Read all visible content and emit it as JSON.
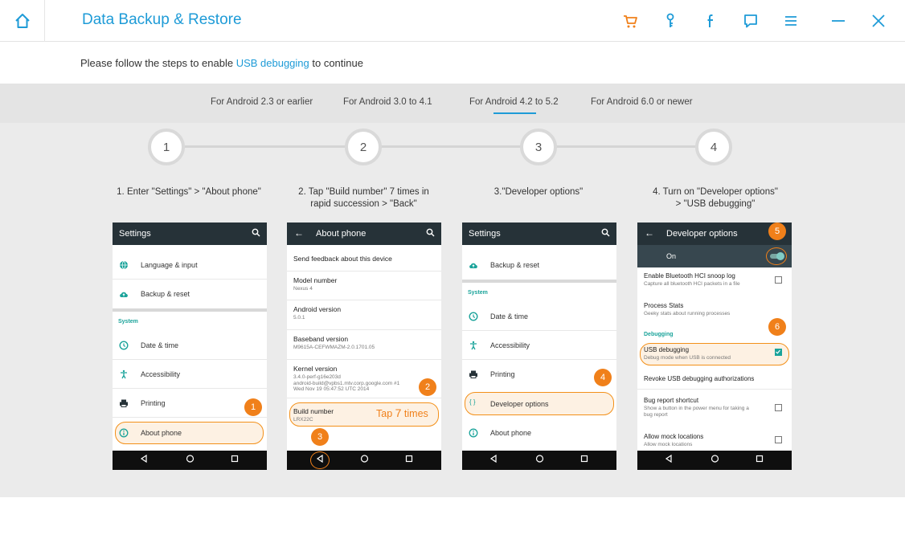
{
  "app": {
    "title": "Data Backup & Restore"
  },
  "instruction": {
    "prefix": "Please follow the steps to enable ",
    "link": "USB debugging",
    "suffix": " to continue"
  },
  "tabs": [
    {
      "label": "For Android 2.3 or earlier"
    },
    {
      "label": "For Android 3.0 to 4.1"
    },
    {
      "label": "For Android 4.2 to 5.2",
      "selected": true
    },
    {
      "label": "For Android 6.0 or newer"
    }
  ],
  "steps": [
    {
      "number": "1",
      "caption_lines": [
        "1. Enter \"Settings\" > \"About phone\""
      ]
    },
    {
      "number": "2",
      "caption_lines": [
        "2. Tap \"Build number\" 7   times in",
        "rapid succession > \"Back\""
      ]
    },
    {
      "number": "3",
      "caption_lines": [
        "3.\"Developer options\""
      ]
    },
    {
      "number": "4",
      "caption_lines": [
        "4. Turn on \"Developer       options\"",
        "> \"USB debugging\""
      ]
    }
  ],
  "phone1": {
    "title": "Settings",
    "items": [
      "Language & input",
      "Backup & reset"
    ],
    "section": "System",
    "system_items": [
      "Date & time",
      "Accessibility",
      "Printing",
      "About phone"
    ],
    "badge": "1"
  },
  "phone2": {
    "title": "About phone",
    "feedback": "Send feedback about this device",
    "model_label": "Model number",
    "model_value": "Nexus 4",
    "android_label": "Android version",
    "android_value": "5.0.1",
    "baseband_label": "Baseband version",
    "baseband_value": "M9615A-CEFWMAZM-2.0.1701.05",
    "kernel_label": "Kernel version",
    "kernel_value_1": "3.4.0-perf-g16e203d",
    "kernel_value_2": "android-build@vpbs1.mtv.corp.google.com #1",
    "kernel_value_3": "Wed Nov 19 05:47:52 UTC 2014",
    "build_label": "Build number",
    "build_value": "LRX22C",
    "tap_prefix": "Tap ",
    "tap_count": "7",
    "tap_suffix": " times",
    "badge_build": "2",
    "badge_back": "3"
  },
  "phone3": {
    "title": "Settings",
    "items": [
      "Backup & reset"
    ],
    "section": "System",
    "system_items": [
      "Date & time",
      "Accessibility",
      "Printing",
      "Developer options",
      "About phone"
    ],
    "badge": "4"
  },
  "phone4": {
    "title": "Developer options",
    "on_label": "On",
    "bt_label": "Enable Bluetooth HCI snoop log",
    "bt_sub": "Capture all bluetooth HCI packets in a file",
    "process_label": "Process Stats",
    "process_sub": "Geeky stats about running processes",
    "section": "Debugging",
    "usb_label": "USB debugging",
    "usb_sub": "Debug mode when USB is connected",
    "revoke_label": "Revoke USB debugging authorizations",
    "bug_label": "Bug report shortcut",
    "bug_sub_1": "Show a button in the power menu for taking a",
    "bug_sub_2": "bug report",
    "mock_label": "Allow mock locations",
    "mock_sub": "Allow mock locations",
    "badge_toggle": "5",
    "badge_usb": "6"
  },
  "colors": {
    "accent_blue": "#1e9bd7",
    "accent_orange": "#f0801a",
    "android_teal": "#1aa39a",
    "toolbar_dark": "#263238"
  },
  "icons": {
    "home": "home-icon",
    "cart": "cart-icon",
    "key": "key-icon",
    "facebook": "facebook-icon",
    "feedback": "chat-icon",
    "menu": "menu-icon",
    "minimize": "minimize-icon",
    "close": "close-icon"
  }
}
